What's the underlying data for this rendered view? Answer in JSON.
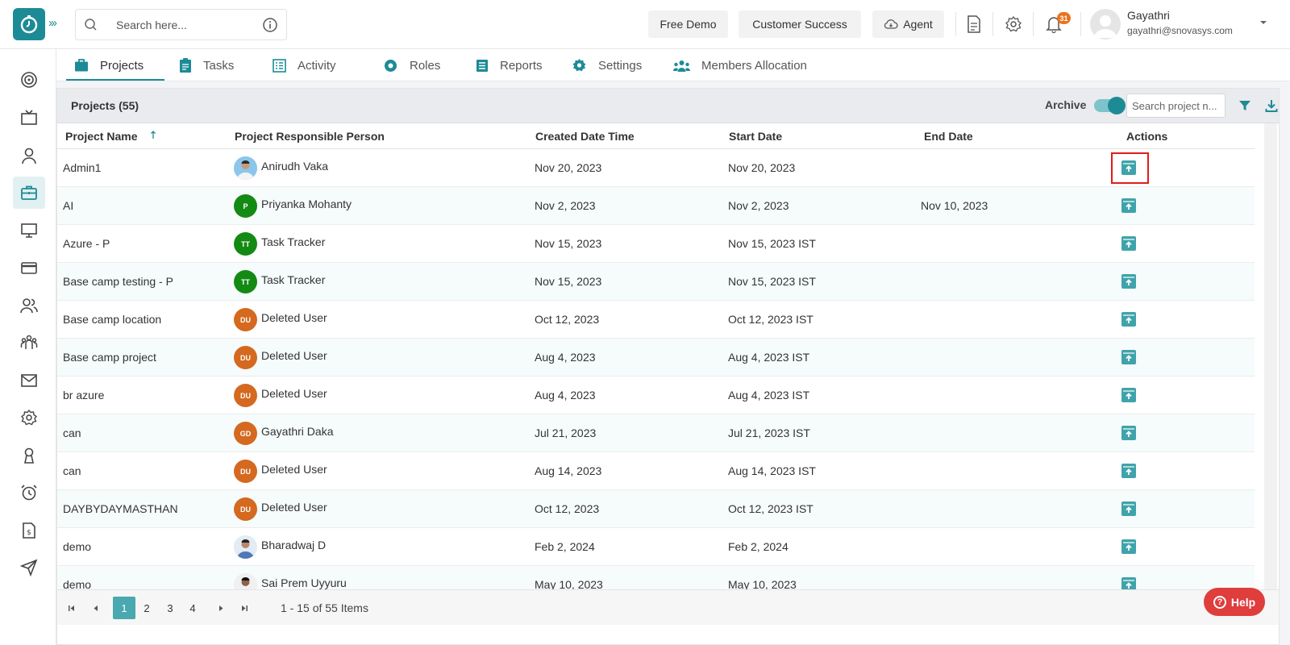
{
  "header": {
    "search_placeholder": "Search here...",
    "free_demo": "Free Demo",
    "customer_success": "Customer Success",
    "agent": "Agent",
    "notification_count": "31",
    "user_name": "Gayathri",
    "user_email": "gayathri@snovasys.com"
  },
  "tabs": [
    {
      "label": "Projects",
      "icon": "briefcase-icon"
    },
    {
      "label": "Tasks",
      "icon": "clipboard-icon"
    },
    {
      "label": "Activity",
      "icon": "activity-list-icon"
    },
    {
      "label": "Roles",
      "icon": "roles-gear-icon"
    },
    {
      "label": "Reports",
      "icon": "reports-icon"
    },
    {
      "label": "Settings",
      "icon": "settings-gear-icon"
    },
    {
      "label": "Members Allocation",
      "icon": "members-icon"
    }
  ],
  "panel": {
    "title": "Projects (55)",
    "archive_label": "Archive",
    "search_placeholder": "Search project n..."
  },
  "columns": [
    "Project Name",
    "Project Responsible Person",
    "Created Date Time",
    "Start Date",
    "End Date",
    "Actions"
  ],
  "rows": [
    {
      "name": "Admin1",
      "person": "Anirudh Vaka",
      "initials": "",
      "created": "Nov 20, 2023",
      "start": "Nov 20, 2023",
      "end": ""
    },
    {
      "name": "AI",
      "person": "Priyanka Mohanty",
      "initials": "P",
      "created": "Nov 2, 2023",
      "start": "Nov 2, 2023",
      "end": "Nov 10, 2023"
    },
    {
      "name": "Azure - P",
      "person": "Task Tracker",
      "initials": "TT",
      "created": "Nov 15, 2023",
      "start": "Nov 15, 2023 IST",
      "end": ""
    },
    {
      "name": "Base camp testing - P",
      "person": "Task Tracker",
      "initials": "TT",
      "created": "Nov 15, 2023",
      "start": "Nov 15, 2023 IST",
      "end": ""
    },
    {
      "name": "Base camp location",
      "person": "Deleted User",
      "initials": "DU",
      "created": "Oct 12, 2023",
      "start": "Oct 12, 2023 IST",
      "end": ""
    },
    {
      "name": "Base camp project",
      "person": "Deleted User",
      "initials": "DU",
      "created": "Aug 4, 2023",
      "start": "Aug 4, 2023 IST",
      "end": ""
    },
    {
      "name": "br azure",
      "person": "Deleted User",
      "initials": "DU",
      "created": "Aug 4, 2023",
      "start": "Aug 4, 2023 IST",
      "end": ""
    },
    {
      "name": "can",
      "person": "Gayathri Daka",
      "initials": "GD",
      "created": "Jul 21, 2023",
      "start": "Jul 21, 2023 IST",
      "end": ""
    },
    {
      "name": "can",
      "person": "Deleted User",
      "initials": "DU",
      "created": "Aug 14, 2023",
      "start": "Aug 14, 2023 IST",
      "end": ""
    },
    {
      "name": "DAYBYDAYMASTHAN",
      "person": "Deleted User",
      "initials": "DU",
      "created": "Oct 12, 2023",
      "start": "Oct 12, 2023 IST",
      "end": ""
    },
    {
      "name": "demo",
      "person": "Bharadwaj D",
      "initials": "",
      "created": "Feb 2, 2024",
      "start": "Feb 2, 2024",
      "end": ""
    },
    {
      "name": "demo",
      "person": "Sai Prem Uyyuru",
      "initials": "",
      "created": "May 10, 2023",
      "start": "May 10, 2023",
      "end": ""
    }
  ],
  "pager": {
    "pages": [
      "1",
      "2",
      "3",
      "4"
    ],
    "info": "1 - 15 of 55 Items"
  },
  "help_label": "Help",
  "colors": {
    "accent": "#1d8b96",
    "green_avatar": "#138a13",
    "orange_avatar": "#d4691f",
    "help": "#e03d3d",
    "highlight": "#e21b1b"
  }
}
